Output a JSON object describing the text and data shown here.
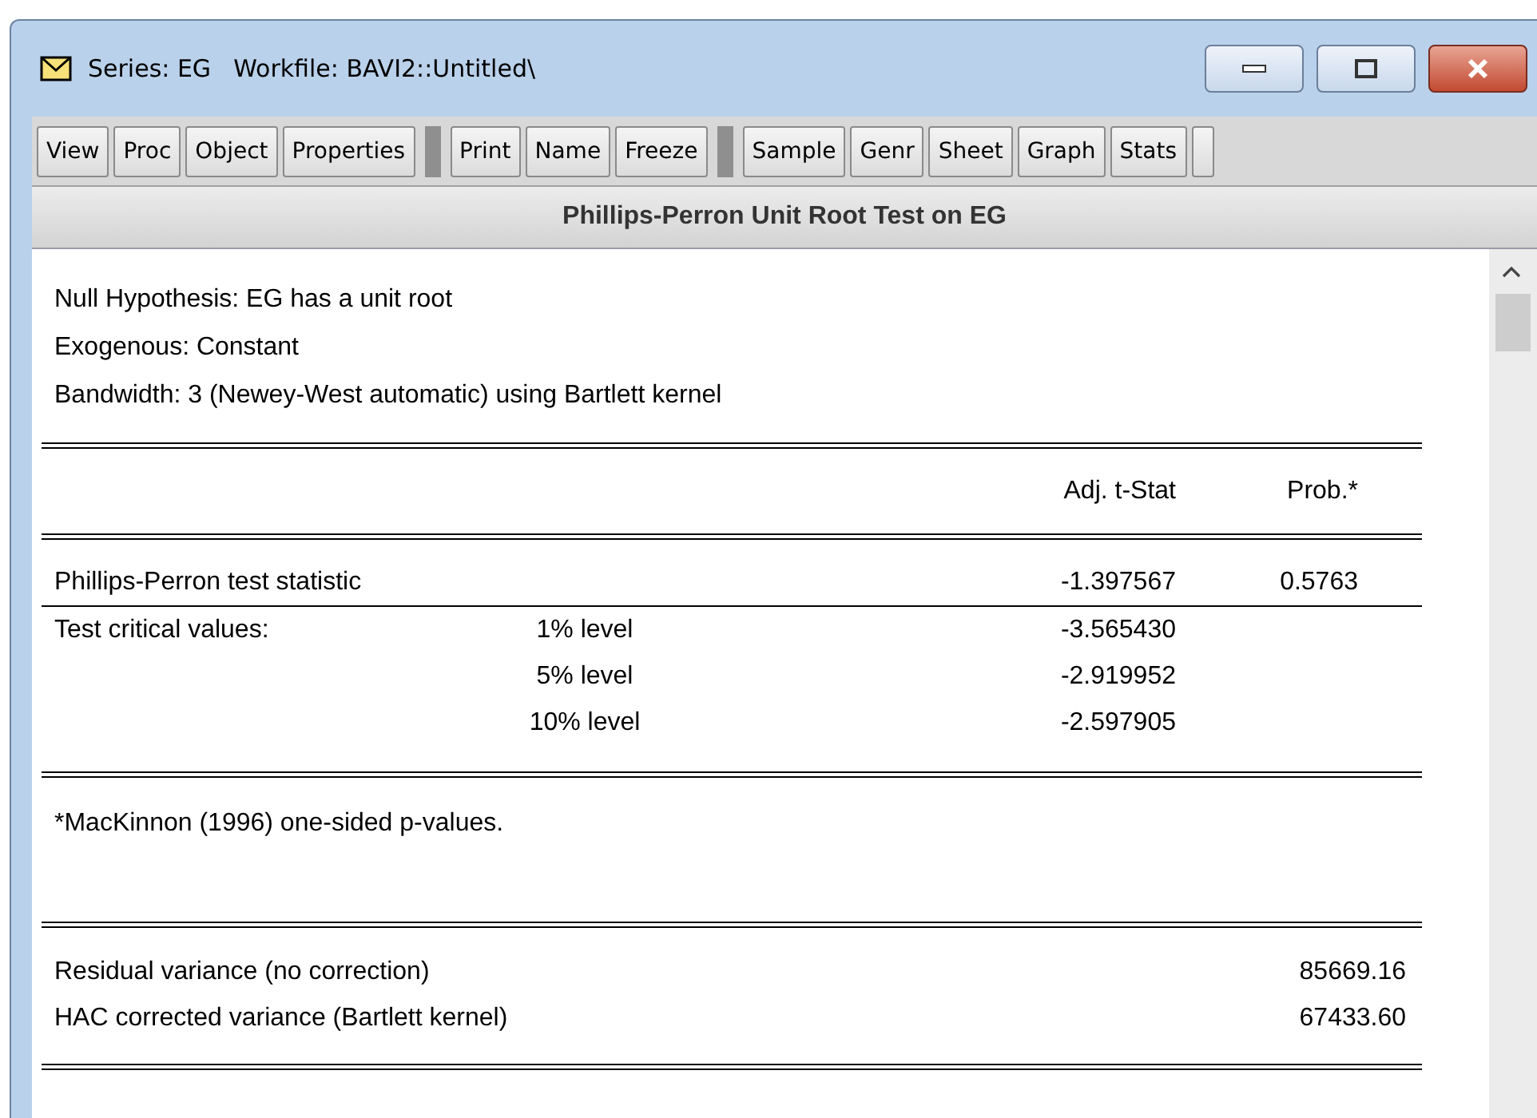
{
  "window": {
    "title": "Series: EG",
    "workfile": "Workfile: BAVI2::Untitled\\"
  },
  "toolbar": [
    [
      "View",
      "Proc",
      "Object",
      "Properties"
    ],
    [
      "Print",
      "Name",
      "Freeze"
    ],
    [
      "Sample",
      "Genr",
      "Sheet",
      "Graph",
      "Stats"
    ]
  ],
  "header": "Phillips-Perron Unit Root Test on EG",
  "intro": [
    "Null Hypothesis: EG has a unit root",
    "Exogenous: Constant",
    "Bandwidth: 3 (Newey-West automatic) using Bartlett kernel"
  ],
  "table": {
    "columns": [
      "Adj. t-Stat",
      "Prob.*"
    ],
    "rows": [
      {
        "label": "Phillips-Perron test statistic",
        "level": "",
        "value": "-1.397567",
        "prob": "0.5763"
      },
      {
        "label": "Test critical values:",
        "level": "1% level",
        "value": "-3.565430",
        "prob": ""
      },
      {
        "label": "",
        "level": "5% level",
        "value": "-2.919952",
        "prob": ""
      },
      {
        "label": "",
        "level": "10% level",
        "value": "-2.597905",
        "prob": ""
      }
    ]
  },
  "footnote": "*MacKinnon (1996) one-sided p-values.",
  "variances": [
    {
      "label": "Residual variance (no correction)",
      "value": "85669.16"
    },
    {
      "label": "HAC corrected variance (Bartlett kernel)",
      "value": "67433.60"
    }
  ]
}
